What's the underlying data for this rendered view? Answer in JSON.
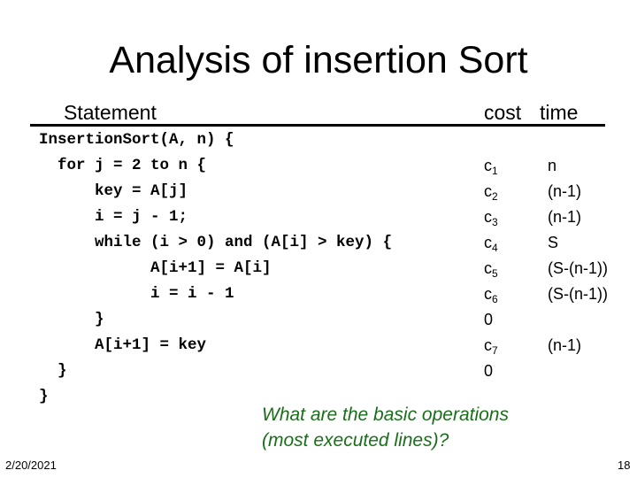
{
  "title": "Analysis of insertion Sort",
  "header": {
    "statement": "Statement",
    "cost": "cost",
    "time": "time"
  },
  "code_lines": [
    "InsertionSort(A, n) {",
    "  for j = 2 to n {",
    "      key = A[j]",
    "      i = j - 1;",
    "      while (i > 0) and (A[i] > key) {",
    "            A[i+1] = A[i]",
    "            i = i - 1",
    "      }",
    "      A[i+1] = key",
    "  }",
    "}"
  ],
  "costs": [
    {
      "base": "c",
      "sub": "1"
    },
    {
      "base": "c",
      "sub": "2"
    },
    {
      "base": "c",
      "sub": "3"
    },
    {
      "base": "c",
      "sub": "4"
    },
    {
      "base": "c",
      "sub": "5"
    },
    {
      "base": "c",
      "sub": "6"
    },
    {
      "base": "0",
      "sub": ""
    },
    {
      "base": "c",
      "sub": "7"
    },
    {
      "base": "0",
      "sub": ""
    }
  ],
  "times": [
    "n",
    "(n-1)",
    "(n-1)",
    "S",
    "(S-(n-1))",
    "(S-(n-1))",
    "",
    "(n-1)",
    ""
  ],
  "question": {
    "line1": "What are the basic operations",
    "line2": "(most executed lines)?",
    "color": "#1a6e1a"
  },
  "footer": {
    "date": "2/20/2021",
    "page": "18"
  }
}
